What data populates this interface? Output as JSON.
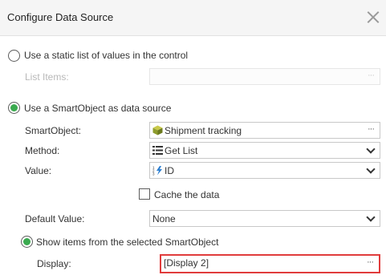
{
  "dialog": {
    "title": "Configure Data Source"
  },
  "static_option": {
    "label": "Use a static list of values in the control",
    "list_items_label": "List Items:",
    "list_items_value": ""
  },
  "smartobject_option": {
    "label": "Use a SmartObject as data source",
    "smartobject_label": "SmartObject:",
    "smartobject_value": "Shipment tracking",
    "smartobject_icon": "smartobject-cube-icon",
    "method_label": "Method:",
    "method_value": "Get List",
    "method_icon": "list-method-icon",
    "value_label": "Value:",
    "value_value": "ID",
    "value_icon": "numeric-autonumber-icon",
    "cache_label": "Cache the data",
    "cache_checked": false,
    "default_label": "Default Value:",
    "default_value": "None"
  },
  "show_items_option": {
    "label": "Show items from the selected SmartObject",
    "display_label": "Display:",
    "display_value": "[Display 2]"
  },
  "common": {
    "ellipsis": "···"
  },
  "colors": {
    "radio_selected": "#3aaa4f",
    "highlight_border": "#e03c3c"
  }
}
